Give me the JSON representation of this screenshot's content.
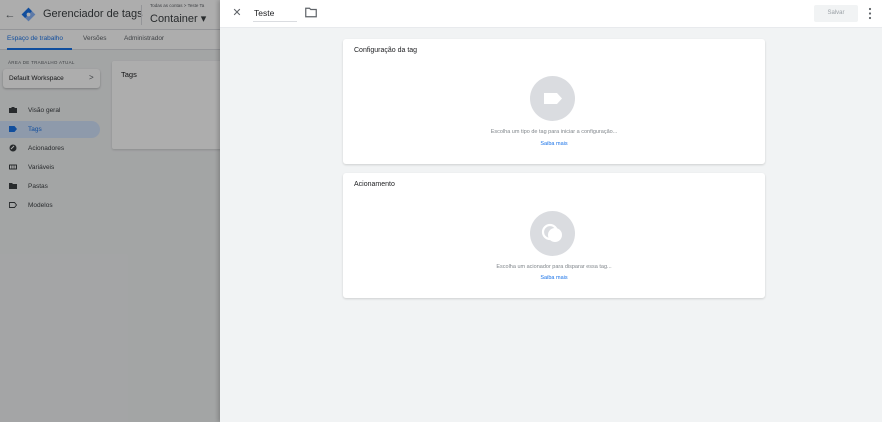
{
  "app": {
    "title": "Gerenciador de tags",
    "breadcrumb": "Todas as contas > Teste Ta",
    "container": "Container ▾"
  },
  "tabs": [
    {
      "label": "Espaço de trabalho",
      "active": true
    },
    {
      "label": "Versões",
      "active": false
    },
    {
      "label": "Administrador",
      "active": false
    }
  ],
  "workspace": {
    "section_label": "ÁREA DE TRABALHO ATUAL",
    "current": "Default Workspace",
    "chevron": ">"
  },
  "nav": [
    {
      "label": "Visão geral",
      "icon": "briefcase-icon",
      "active": false
    },
    {
      "label": "Tags",
      "icon": "tag-icon",
      "active": true
    },
    {
      "label": "Acionadores",
      "icon": "trigger-icon",
      "active": false
    },
    {
      "label": "Variáveis",
      "icon": "variables-icon",
      "active": false
    },
    {
      "label": "Pastas",
      "icon": "folder-icon",
      "active": false
    },
    {
      "label": "Modelos",
      "icon": "templates-icon",
      "active": false
    }
  ],
  "tags_card": {
    "title": "Tags"
  },
  "editor": {
    "close_glyph": "✕",
    "name": "Teste",
    "save_label": "Salvar",
    "tag_config": {
      "title": "Configuração da tag",
      "hint": "Escolha um tipo de tag para iniciar a configuração...",
      "learn_more": "Saiba mais"
    },
    "triggering": {
      "title": "Acionamento",
      "hint": "Escolha um acionador para disparar essa tag...",
      "learn_more": "Saiba mais"
    }
  },
  "colors": {
    "accent": "#1a73e8",
    "nav_active_bg": "#d2e3fc",
    "placeholder_gray": "#dadce0",
    "panel_bg": "#f1f3f4"
  }
}
